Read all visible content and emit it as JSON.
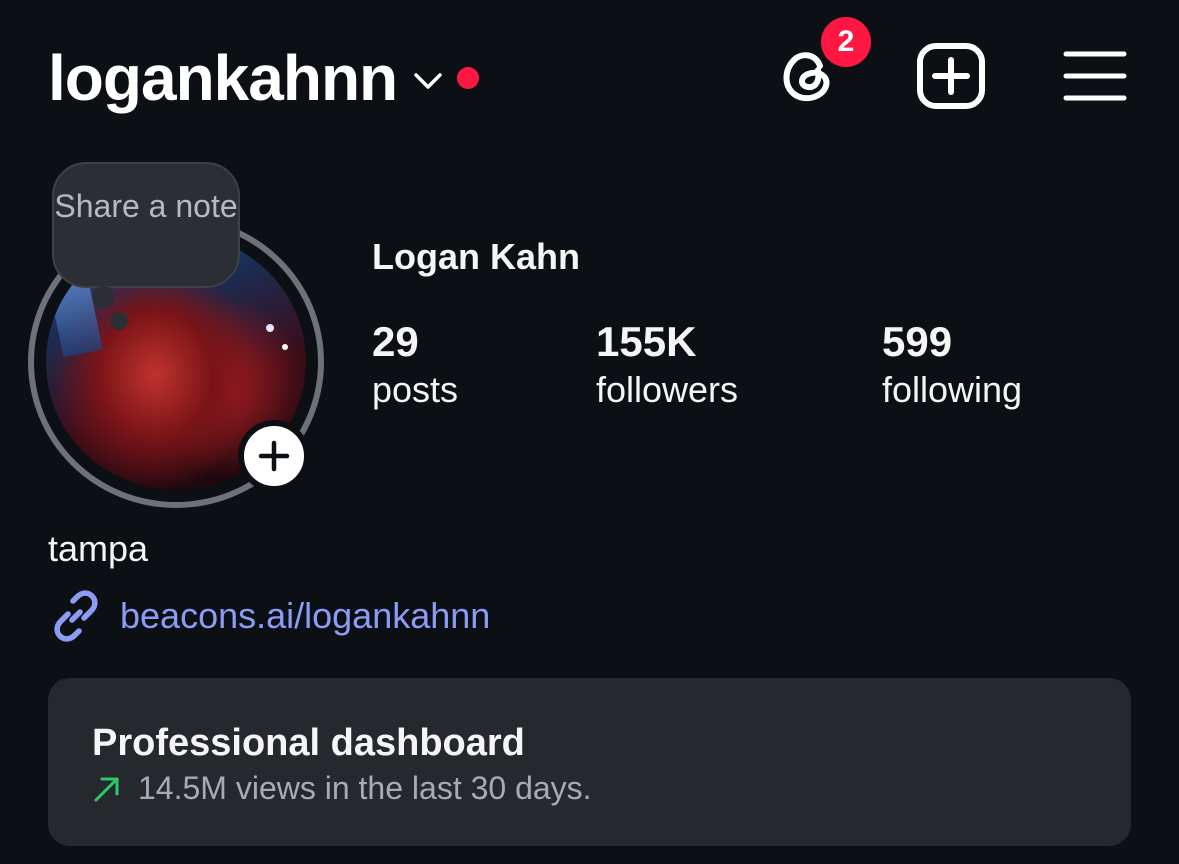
{
  "header": {
    "username": "logankahnn",
    "notification_badge": "2",
    "colors": {
      "red_dot": "#ff1744",
      "badge": "#ff1744"
    },
    "icons": [
      "chevron-down-icon",
      "threads-icon",
      "create-plus-icon",
      "menu-icon"
    ]
  },
  "note": {
    "text": "Share a note"
  },
  "profile": {
    "full_name": "Logan Kahn",
    "stats": [
      {
        "value": "29",
        "label": "posts"
      },
      {
        "value": "155K",
        "label": "followers"
      },
      {
        "value": "599",
        "label": "following"
      }
    ],
    "location": "tampa",
    "link": "beacons.ai/logankahnn",
    "link_color": "#8c9cf5"
  },
  "dashboard": {
    "title": "Professional dashboard",
    "subtitle": "14.5M views in the last 30 days.",
    "trend_color": "#2ec866"
  }
}
